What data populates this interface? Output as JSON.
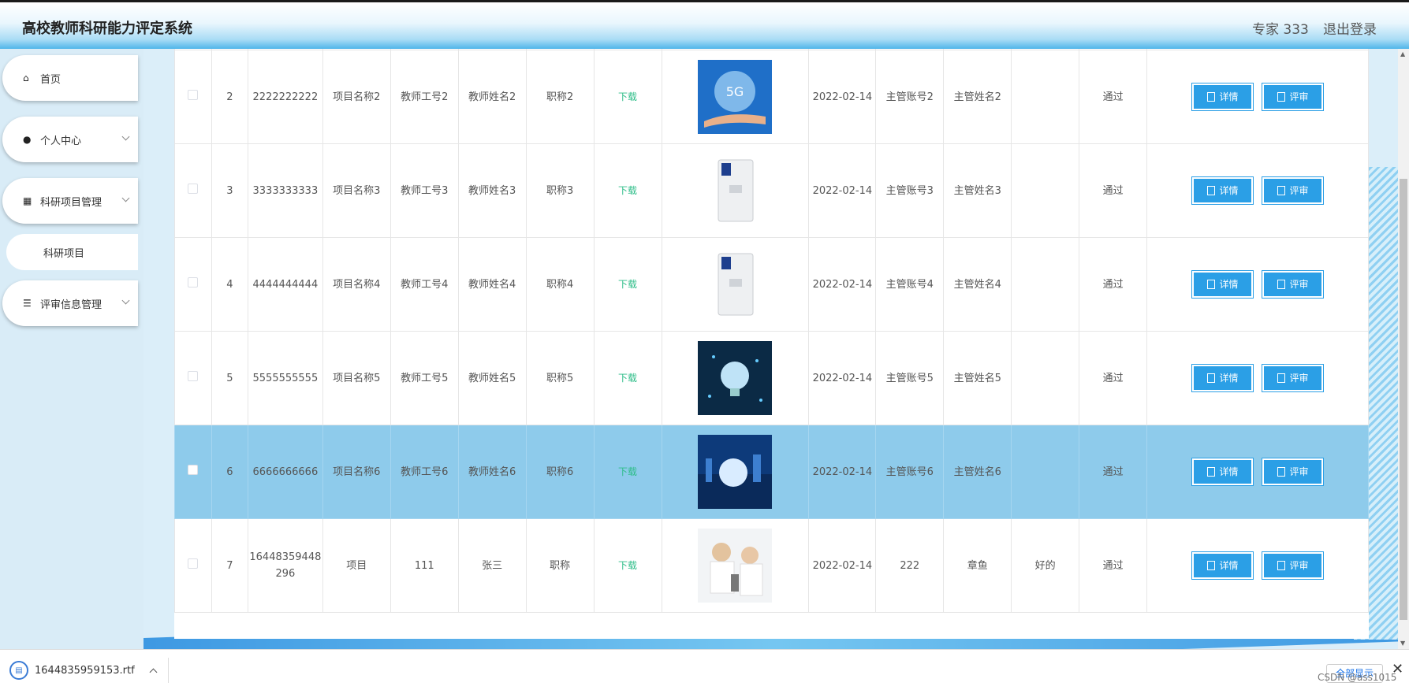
{
  "header": {
    "title": "高校教师科研能力评定系统",
    "user": "专家 333",
    "logout": "退出登录"
  },
  "sidebar": {
    "items": [
      {
        "label": "首页",
        "icon": "home-icon"
      },
      {
        "label": "个人中心",
        "icon": "user-icon"
      },
      {
        "label": "科研项目管理",
        "icon": "grid-icon"
      },
      {
        "label": "评审信息管理",
        "icon": "sliders-icon"
      }
    ],
    "sub_item": "科研项目"
  },
  "table": {
    "download_label": "下载",
    "detail_label": "详情",
    "review_label": "评审",
    "rows": [
      {
        "no": "2",
        "code": "2222222222",
        "name": "项目名称2",
        "tid": "教师工号2",
        "tname": "教师姓名2",
        "title": "职称2",
        "date": "2022-02-14",
        "acct": "主管账号2",
        "mgr": "主管姓名2",
        "comment": "",
        "status": "通过",
        "image": "5g-hand-image"
      },
      {
        "no": "3",
        "code": "3333333333",
        "name": "项目名称3",
        "tid": "教师工号3",
        "tname": "教师姓名3",
        "title": "职称3",
        "date": "2022-02-14",
        "acct": "主管账号3",
        "mgr": "主管姓名3",
        "comment": "",
        "status": "通过",
        "image": "water-purifier-image"
      },
      {
        "no": "4",
        "code": "4444444444",
        "name": "项目名称4",
        "tid": "教师工号4",
        "tname": "教师姓名4",
        "title": "职称4",
        "date": "2022-02-14",
        "acct": "主管账号4",
        "mgr": "主管姓名4",
        "comment": "",
        "status": "通过",
        "image": "water-purifier-image"
      },
      {
        "no": "5",
        "code": "5555555555",
        "name": "项目名称5",
        "tid": "教师工号5",
        "tname": "教师姓名5",
        "title": "职称5",
        "date": "2022-02-14",
        "acct": "主管账号5",
        "mgr": "主管姓名5",
        "comment": "",
        "status": "通过",
        "image": "lightbulb-network-image"
      },
      {
        "no": "6",
        "code": "6666666666",
        "name": "项目名称6",
        "tid": "教师工号6",
        "tname": "教师姓名6",
        "title": "职称6",
        "date": "2022-02-14",
        "acct": "主管账号6",
        "mgr": "主管姓名6",
        "comment": "",
        "status": "通过",
        "image": "globe-city-image"
      },
      {
        "no": "7",
        "code": "16448359448296",
        "name": "项目",
        "tid": "111",
        "tname": "张三",
        "title": "职称",
        "date": "2022-02-14",
        "acct": "222",
        "mgr": "章鱼",
        "comment": "好的",
        "status": "通过",
        "image": "lab-researchers-image"
      }
    ],
    "selected_row": "6"
  },
  "download_bar": {
    "filename": "1644835959153.rtf",
    "show_all": "全部显示",
    "watermark": "CSDN @ass1015"
  },
  "colors": {
    "accent": "#2b9fe6",
    "selected_row": "#8ecbeb",
    "download_link": "#2dbd88",
    "sidebar_bg": "#d9ecf7"
  }
}
